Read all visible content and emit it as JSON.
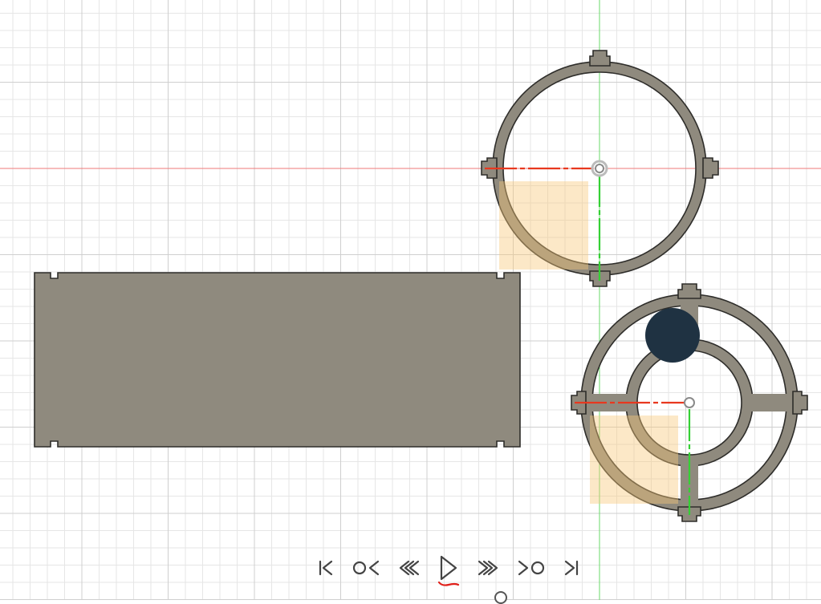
{
  "viewport": {
    "background": "#ffffff",
    "grid_minor_color": "#e6e6e6",
    "grid_major_color": "#cfcfcf",
    "x_axis_color": "#ef7a7a",
    "y_axis_color": "#6ad86a"
  },
  "bodies": [
    {
      "name": "side-wall-panel",
      "shape": "rectangle-with-corner-slots",
      "color": "#8f8a7e"
    },
    {
      "name": "outer-ring",
      "shape": "ring-with-four-tabs",
      "color": "#8f8a7e"
    },
    {
      "name": "spoked-ring",
      "shape": "double-ring-with-four-spokes",
      "color": "#8f8a7e"
    }
  ],
  "selection": {
    "highlight_color": "#f9c77a"
  },
  "cursor_marker": {
    "color": "#1f3242"
  },
  "timeline": {
    "controls": [
      {
        "icon": "skip-to-start-icon"
      },
      {
        "icon": "step-back-keyframe-icon"
      },
      {
        "icon": "rewind-icon"
      },
      {
        "icon": "play-icon",
        "active_underline_color": "#e0201a"
      },
      {
        "icon": "fast-forward-icon"
      },
      {
        "icon": "step-forward-keyframe-icon"
      },
      {
        "icon": "skip-to-end-icon"
      }
    ]
  }
}
